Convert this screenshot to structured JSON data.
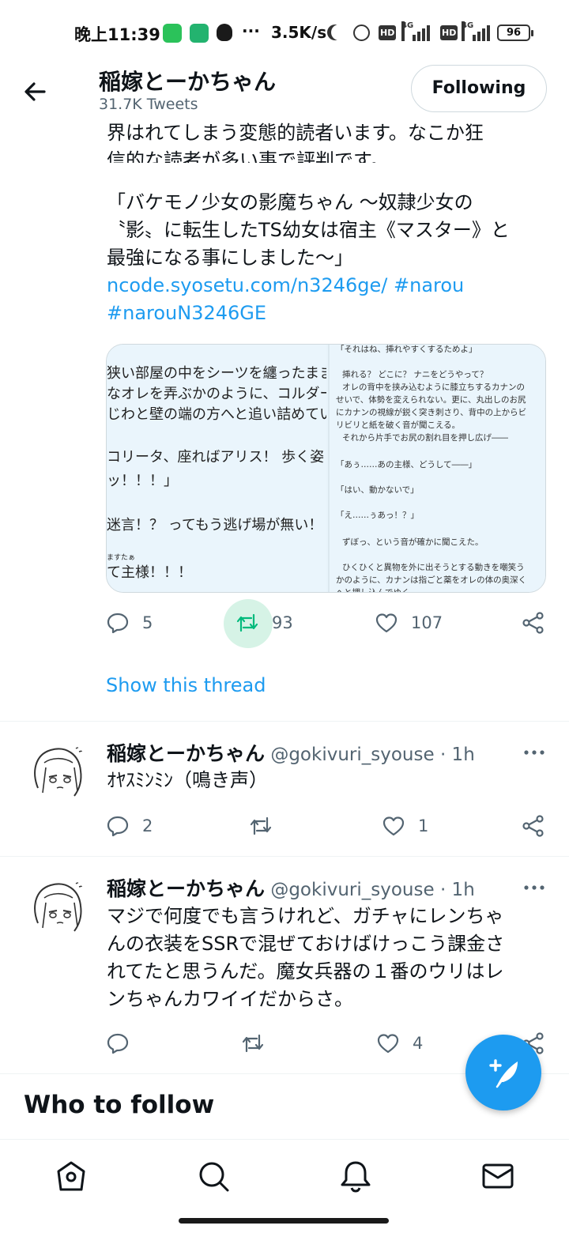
{
  "status_bar": {
    "time": "晚上11:39",
    "more": "···",
    "speed": "3.5K/s",
    "hd": "HD",
    "net": "4G",
    "battery": "96"
  },
  "header": {
    "name": "稲嫁とーかちゃん",
    "tweet_count": "31.7K Tweets",
    "following_label": "Following"
  },
  "main_tweet": {
    "clipped_lines": [
      "界はれてしまう変態的読者います。なこか狂",
      "信的な読者が多い事で評判です。"
    ],
    "lines": [
      "「バケモノ少女の影魔ちゃん 〜奴隷少女の",
      "〝影〟に転生したTS幼女は宿主《マスター》と",
      "最強になる事にしました〜」"
    ],
    "link1": "ncode.syosetu.com/n3246ge/",
    "hashtag1": "#narou",
    "hashtag2": "#narouN3246GE",
    "media_left_lines": [
      "狭い部屋の中をシーツを纏ったまま",
      "なオレを弄ぶかのように、コルダー",
      "じわと壁の端の方へと追い詰めてい",
      "",
      "コリータ、座ればアリス！ 歩く姿",
      "ッ！！！」",
      "",
      "迷言！？ ってもう逃げ場が無い！",
      "",
      "て主様！！！"
    ],
    "media_ruby": "ますたぁ",
    "media_right_lines": [
      "「それはね、挿れやすくするためよ」",
      "",
      "挿れる？ どこに？ ナニをどうやって？",
      "オレの背中を挟み込むように膝立ちするカナンの",
      "せいで、体勢を変えられない。更に、丸出しのお尻",
      "にカナンの視線が鋭く突き刺さり、背中の上からビ",
      "リビリと紙を破く音が聞こえる。",
      "それから片手でお尻の割れ目を押し広げ――",
      "",
      "「あぅ……あの主様、どうして――」",
      "",
      "「はい、動かないで」",
      "",
      "「え……ぅあっ！？」",
      "",
      "ずぼっ、という音が確かに聞こえた。",
      "",
      "ひくひくと異物を外に出そうとする動きを嘲笑う",
      "かのように、カナンは指ごと薬をオレの体の奥深く",
      "へと押し込んでゆく"
    ],
    "reply_count": "5",
    "retweet_count": "93",
    "like_count": "107"
  },
  "show_thread": "Show this thread",
  "reply1": {
    "name": "稲嫁とーかちゃん",
    "handle": "@gokivuri_syouse",
    "time": "· 1h",
    "text": "ｵﾔｽﾐﾝﾐﾝ（鳴き声）",
    "reply_count": "2",
    "retweet_count": "",
    "like_count": "1"
  },
  "reply2": {
    "name": "稲嫁とーかちゃん",
    "handle": "@gokivuri_syouse",
    "time": "· 1h",
    "lines": [
      "マジで何度でも言うけれど、ガチャにレンちゃ",
      "んの衣装をSSRで混ぜておけばけっこう課金さ",
      "れてたと思うんだ。魔女兵器の１番のウリはレ",
      "ンちゃんカワイイだからさ。"
    ],
    "reply_count": "",
    "retweet_count": "",
    "like_count": "4"
  },
  "who_to_follow": "Who to follow",
  "colors": {
    "accent": "#1d9bf0",
    "retweet_highlight": "#d6f3e6",
    "text_primary": "#0f1419",
    "text_secondary": "#536471"
  },
  "icons": [
    "back-arrow-icon",
    "reply-icon",
    "retweet-icon",
    "like-icon",
    "share-icon",
    "more-icon",
    "compose-icon",
    "home-icon",
    "search-icon",
    "notifications-icon",
    "messages-icon"
  ]
}
